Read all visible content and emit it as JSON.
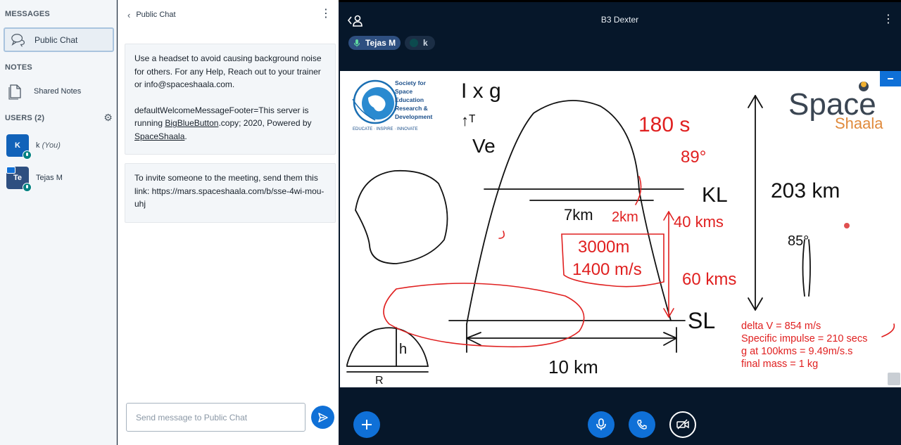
{
  "sidebar": {
    "messages_title": "MESSAGES",
    "public_chat_label": "Public Chat",
    "notes_title": "NOTES",
    "shared_notes_label": "Shared Notes",
    "users_title": "USERS (2)",
    "users": [
      {
        "initials": "K",
        "name": "k",
        "suffix": "(You)",
        "color": "#1162b9"
      },
      {
        "initials": "Te",
        "name": "Tejas M",
        "color": "#2e4f80"
      }
    ]
  },
  "chat": {
    "title": "Public Chat",
    "welcome": {
      "line1": "Use a headset to avoid causing background noise for others. For any Help, Reach out to your trainer or info@spaceshaala.com.",
      "line2_prefix": "defaultWelcomeMessageFooter=This server is running ",
      "line2_link": "BigBlueButton",
      "line2_mid": ".copy; 2020, Powered by ",
      "line2_link2": "SpaceShaala",
      "line2_end": "."
    },
    "invite": "To invite someone to the meeting, send them this link: https://mars.spaceshaala.com/b/sse-4wi-mou-uhj",
    "input_placeholder": "Send message to Public Chat"
  },
  "meeting": {
    "title": "B3 Dexter",
    "talkers": [
      {
        "name": "Tejas M",
        "active": true
      },
      {
        "name": "k",
        "active": false
      }
    ]
  },
  "whiteboard": {
    "sser_logo": {
      "line1": "Society for",
      "line2": "Space",
      "line3": "Education",
      "line4": "Research &",
      "line5": "Development",
      "tagline": "EDUCATE · INSPIRE · INNOVATE"
    },
    "spaceshaala_logo": {
      "top": "Space",
      "bottom": "Shaala"
    },
    "notes": [
      "delta V = 854 m/s",
      "Specific impulse = 210 secs",
      "g at 100kms = 9.49m/s.s",
      "final mass = 1 kg"
    ],
    "handwriting": {
      "t1": "I x g",
      "t2": "↑ᵀ",
      "t3": "Ve",
      "t4": "180 s",
      "t5": "89°",
      "t6": "KL",
      "t7": "203 km",
      "t8": "7km",
      "t9": "2km",
      "t10": "40 kms",
      "t11": "3000m",
      "t12": "1400 m/s",
      "t13": "60 kms",
      "t14": "SL",
      "t15": "10 km",
      "t16": "R",
      "t17": "h",
      "t18": "85°"
    }
  }
}
